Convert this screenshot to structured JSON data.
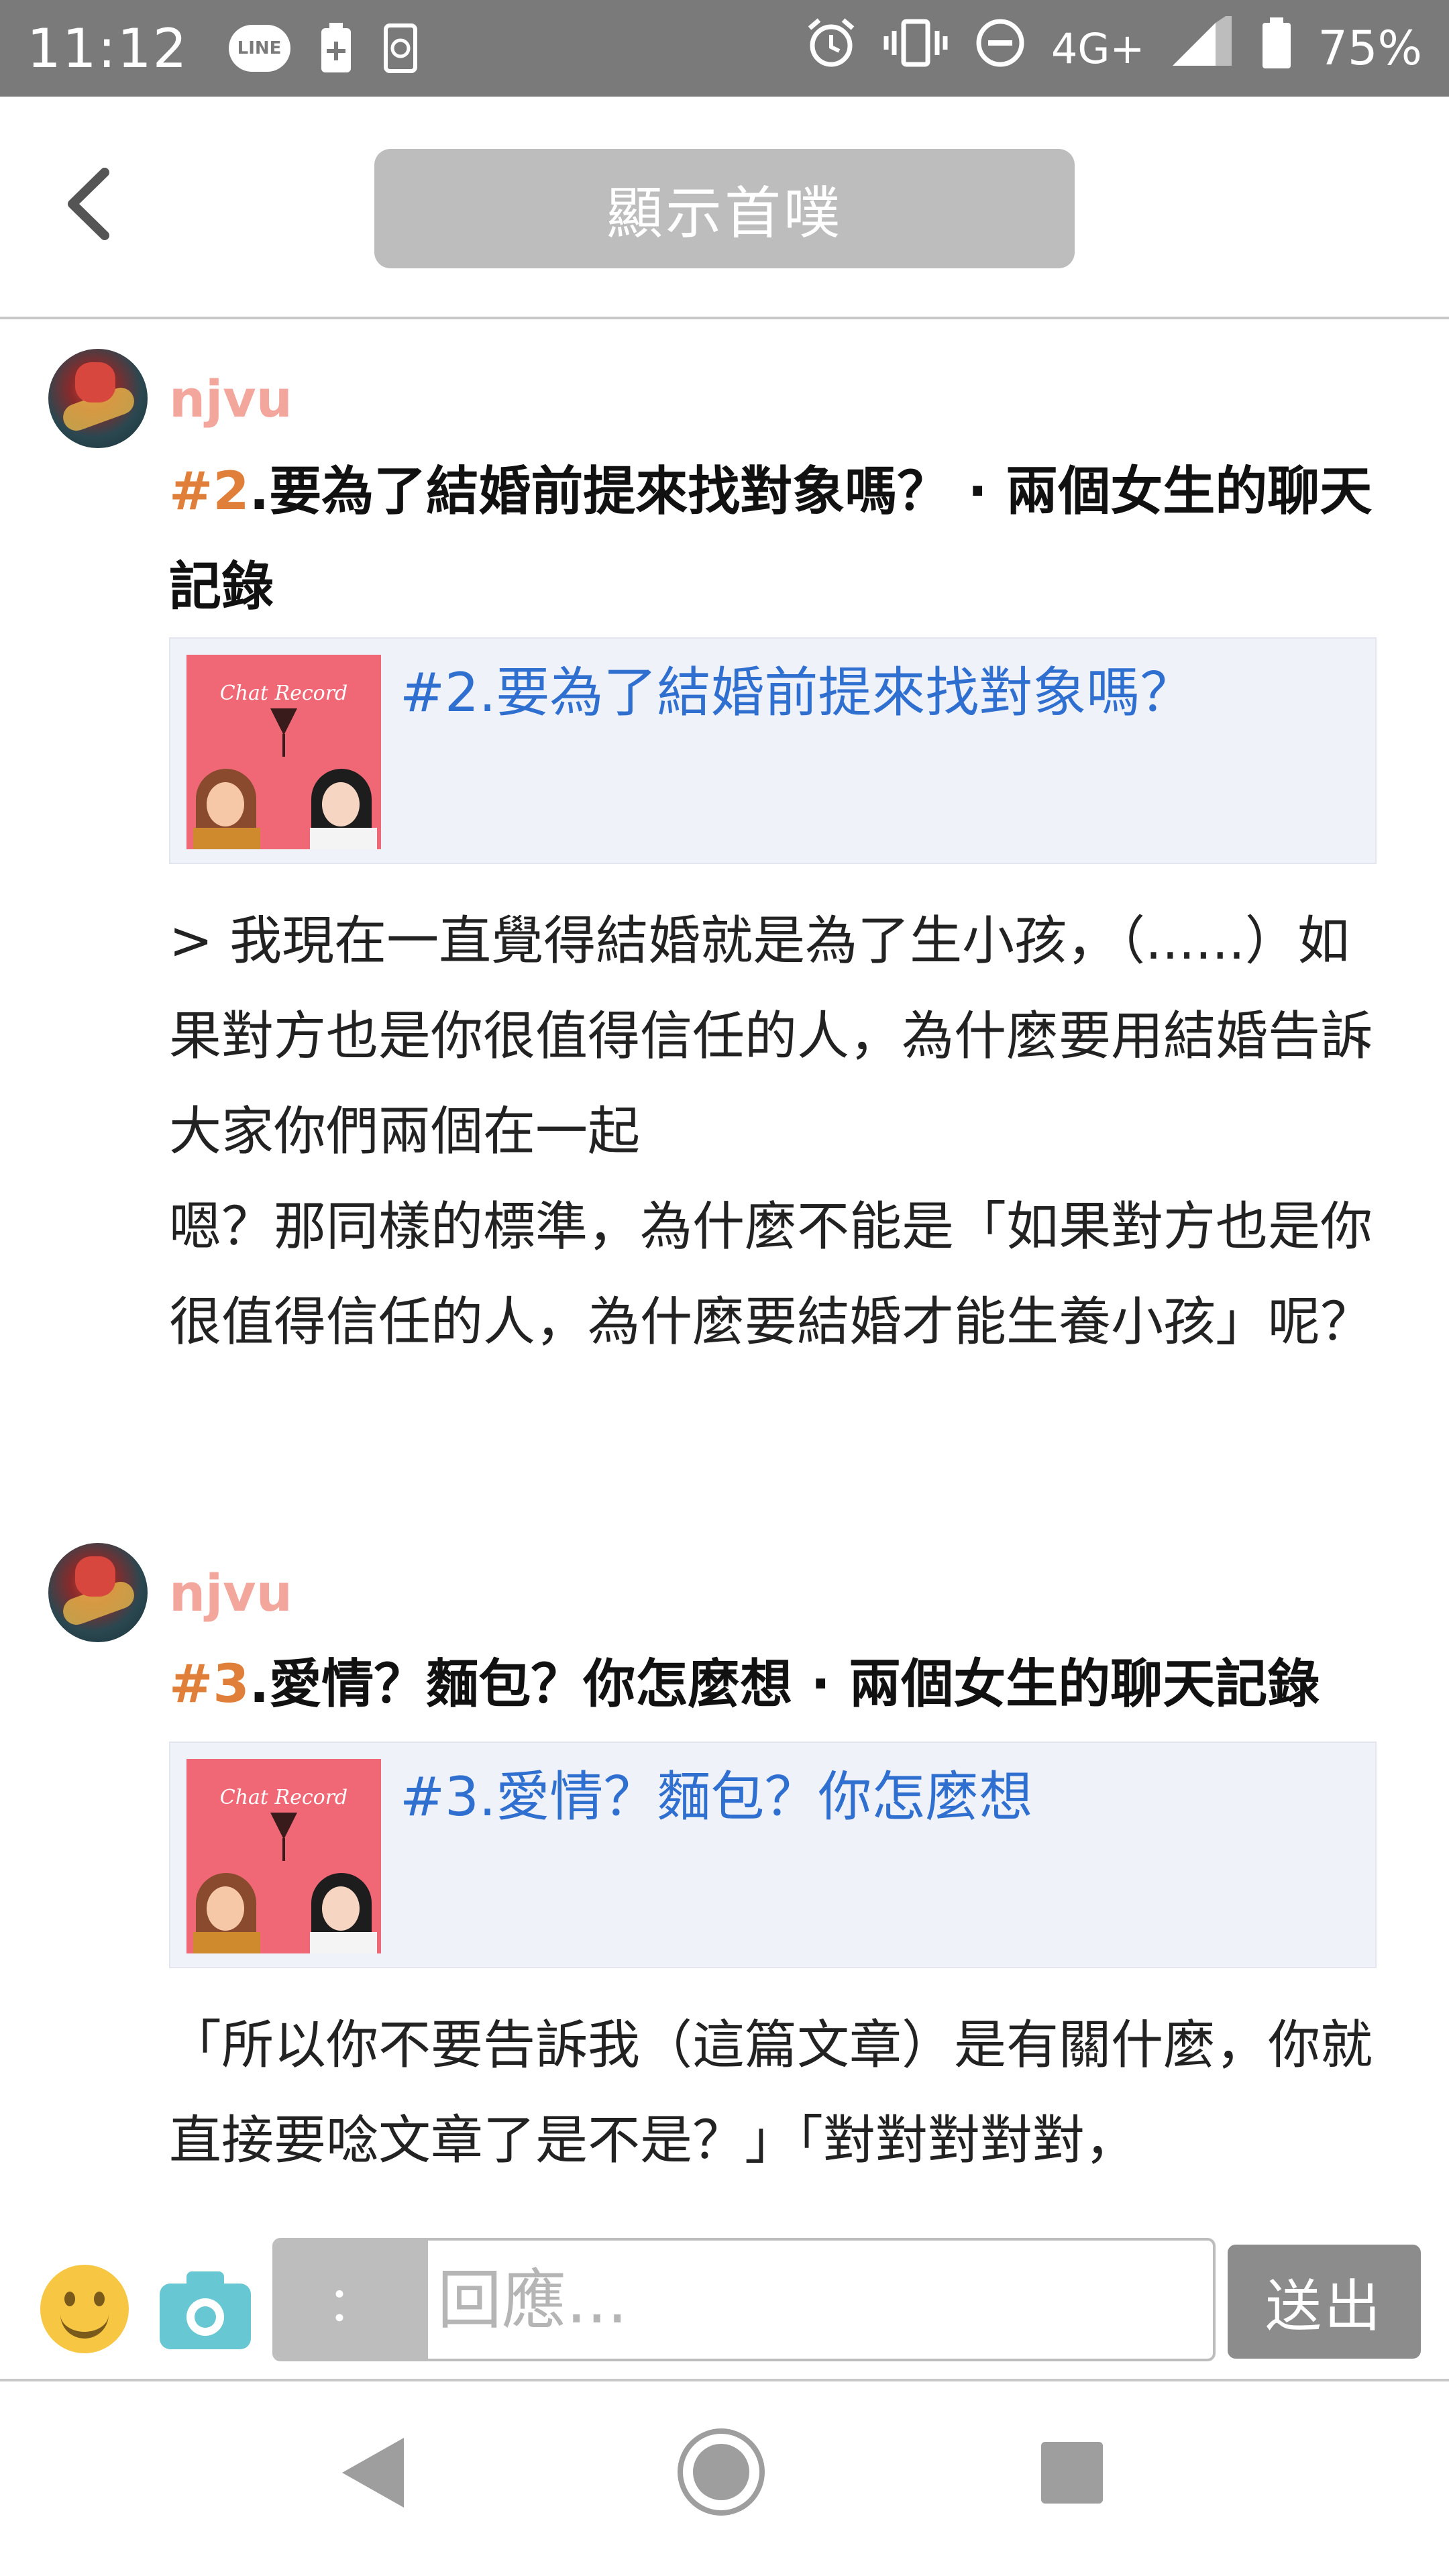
{
  "status_bar": {
    "time": "11:12",
    "line_app": "LINE",
    "network": "4G+",
    "battery": "75%"
  },
  "header": {
    "show_first_label": "顯示首噗"
  },
  "posts": [
    {
      "author": "njvu",
      "title_num": "#2",
      "title_text": ".要為了結婚前提來找對象嗎？ · 兩個女生的聊天記錄",
      "link_title": "#2.要為了結婚前提來找對象嗎？",
      "thumb_title": "Chat Record",
      "body": [
        "> 我現在一直覺得結婚就是為了生小孩，（......）如果對方也是你很值得信任的人，為什麼要用結婚告訴大家你們兩個在一起",
        "嗯？那同樣的標準，為什麼不能是「如果對方也是你很值得信任的人，為什麼要結婚才能生養小孩」呢？"
      ]
    },
    {
      "author": "njvu",
      "title_num": "#3",
      "title_text": ".愛情？麵包？你怎麼想 · 兩個女生的聊天記錄",
      "link_title": "#3.愛情？麵包？你怎麼想",
      "thumb_title": "Chat Record",
      "body": [
        "「所以你不要告訴我（這篇文章）是有關什麼，你就直接要唸文章了是不是？」「對對對對對，"
      ]
    }
  ],
  "reply_bar": {
    "qualifier": "：",
    "placeholder": "回應...",
    "send_label": "送出"
  },
  "colors": {
    "author": "#f2a69c",
    "title_number": "#e07f3a",
    "link": "#2f6fd0",
    "status_bar": "#7a7a7a"
  }
}
